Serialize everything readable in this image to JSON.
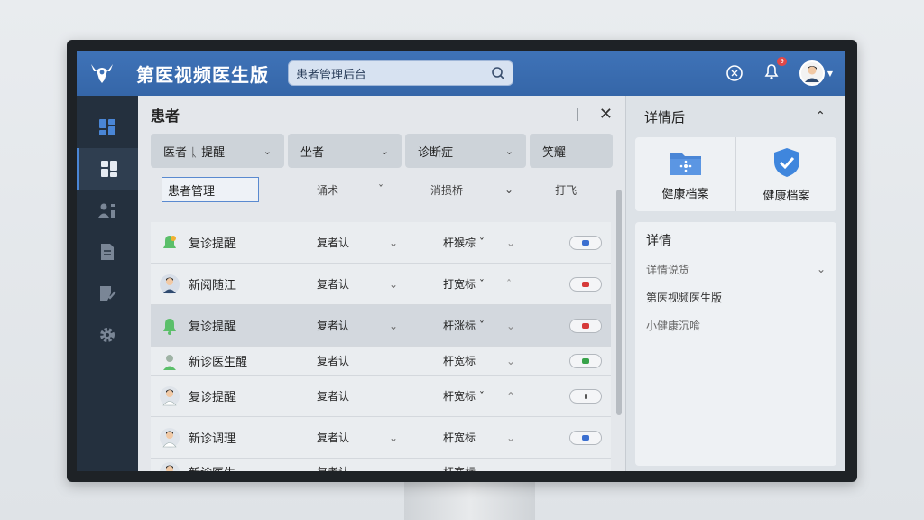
{
  "app": {
    "title": "第医视频医生版"
  },
  "search": {
    "value": "患者管理后台"
  },
  "header": {
    "badge": "9"
  },
  "main": {
    "title": "患者",
    "filters": [
      {
        "label": "医者 ᚳ 提醒"
      },
      {
        "label": "坐者"
      },
      {
        "label": "诊断症"
      },
      {
        "label": "笑耀"
      }
    ],
    "sub": {
      "input_value": "患者管理",
      "c2": "诵术",
      "c3": "消损桥",
      "c4": "打飞"
    },
    "rows": [
      {
        "name": "复诊提醒",
        "c2": "复者认",
        "c3": "杆猴棕 ˇ",
        "color": "#3b6fd0"
      },
      {
        "name": "新阅随江",
        "c2": "复者认",
        "c3": "打宽标 ˇ",
        "color": "#d63a3a"
      },
      {
        "name": "复诊提醒",
        "c2": "复者认",
        "c3": "杆涨标 ˇ",
        "color": "#d63a3a"
      },
      {
        "name": "新诊医生醒",
        "c2": "复者认",
        "c3": "杆宽标",
        "color": "#38a34a"
      },
      {
        "name": "复诊提醒",
        "c2": "复者认",
        "c3": "杆宽标 ˇ",
        "color": "#555555"
      },
      {
        "name": "新诊调理",
        "c2": "复者认",
        "c3": "杆宽标",
        "color": "#3b6fd0"
      },
      {
        "name": "新诊医生",
        "c2": "复者认",
        "c3": "杆宽标",
        "color": "#888888"
      }
    ]
  },
  "right": {
    "title": "详情后",
    "cards": [
      {
        "label": "健康档案"
      },
      {
        "label": "健康档案"
      }
    ],
    "details_title": "详情",
    "details": [
      "详情说货",
      "第医视频医生版",
      "小健康沉喰"
    ]
  },
  "colors": {
    "accent": "#3f73b8",
    "sidebar": "#24303e"
  }
}
